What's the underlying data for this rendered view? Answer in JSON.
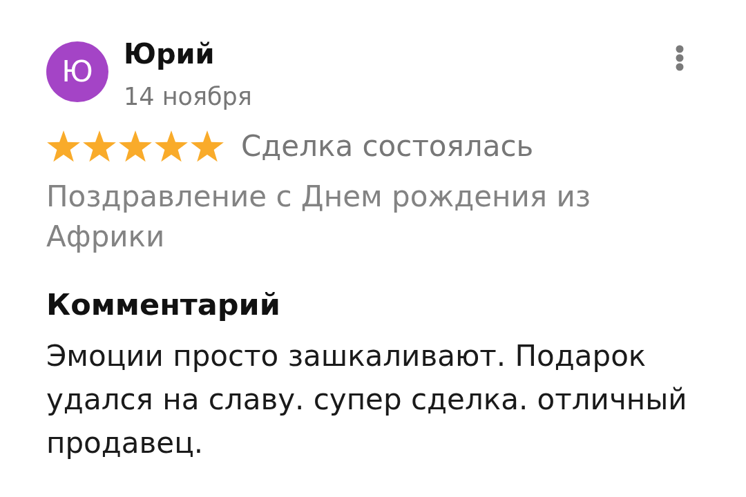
{
  "review": {
    "avatar": {
      "initial": "Ю"
    },
    "author": "Юрий",
    "date": "14 ноября",
    "stars": 5,
    "status": "Сделка состоялась",
    "title": "Поздравление с Днем рождения из Африки",
    "comment_heading": "Комментарий",
    "comment": "Эмоции просто зашкаливают. Подарок удался на славу. супер сделка. отличный продавец."
  }
}
